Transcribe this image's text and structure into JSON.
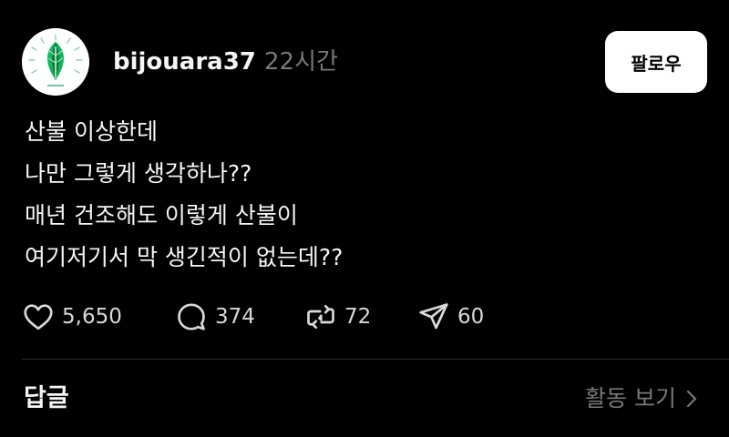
{
  "post": {
    "author": {
      "username": "bijouara37",
      "avatar_icon": "green-leaf-logo-icon"
    },
    "timestamp": "22시간",
    "follow_label": "팔로우",
    "body_lines": [
      "산불 이상한데",
      "나만 그렇게 생각하나??",
      "매년 건조해도 이렇게 산불이",
      "여기저기서 막 생긴적이 없는데??"
    ],
    "stats": {
      "likes": "5,650",
      "comments": "374",
      "reposts": "72",
      "shares": "60"
    }
  },
  "replies": {
    "label": "답글",
    "view_activity_label": "활동 보기"
  },
  "colors": {
    "background": "#000000",
    "primary_text": "#f3f5f7",
    "secondary_text": "#777777",
    "follow_button_bg": "#ffffff",
    "divider": "#2c2c2c"
  }
}
